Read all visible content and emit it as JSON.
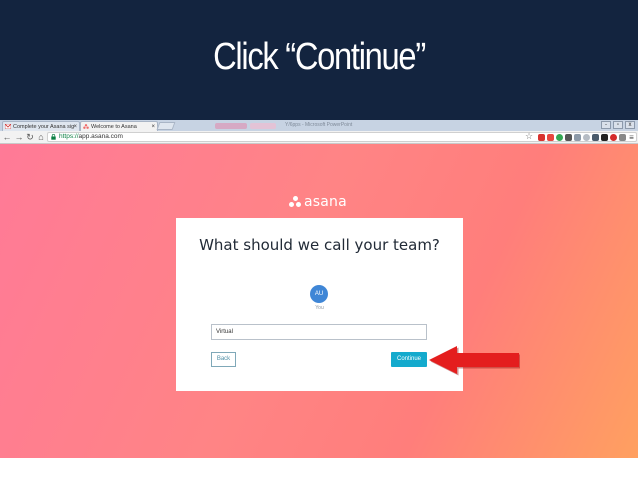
{
  "slide": {
    "title": "Click “Continue”"
  },
  "browser": {
    "tabs": [
      {
        "label": "Complete your Asana sig",
        "favicon": "gmail-icon"
      },
      {
        "label": "Welcome to Asana",
        "favicon": "asana-icon"
      }
    ],
    "faded_tab_text": "Y/6pps - Microsoft PowerPoint",
    "url_scheme": "https://",
    "url_host": "app.asana.com",
    "window_controls": [
      "-",
      "▫",
      "x"
    ]
  },
  "page": {
    "logo_text": "asana",
    "title": "What should we call your team?",
    "avatar_initials": "AU",
    "avatar_caption": "You",
    "team_name_value": "Virtual",
    "back_label": "Back",
    "continue_label": "Continue"
  },
  "colors": {
    "banner": "#13243f",
    "continue_button": "#14aacd",
    "arrow": "#e41e1e",
    "avatar": "#3f86d6"
  }
}
